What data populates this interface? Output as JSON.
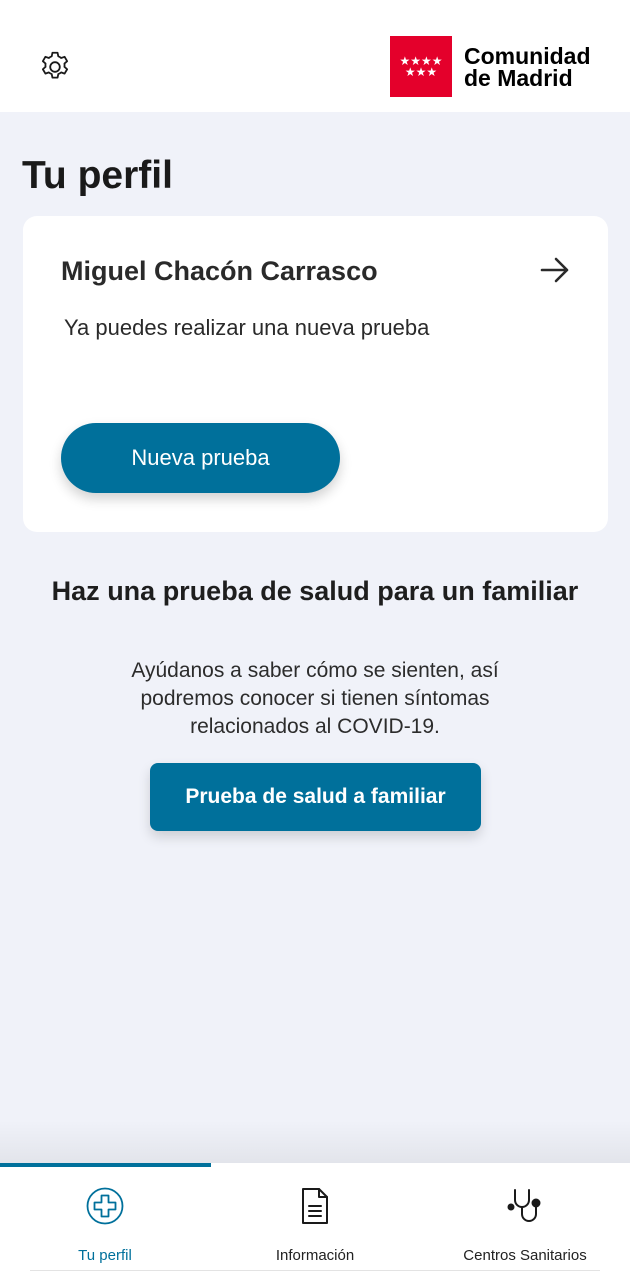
{
  "header": {
    "settings_icon": "gear-icon",
    "logo": {
      "line1": "Comunidad",
      "line2": "de Madrid",
      "flag_color": "#e4002b"
    }
  },
  "page": {
    "title": "Tu perfil"
  },
  "profile_card": {
    "name": "Miguel Chacón Carrasco",
    "subtitle": "Ya puedes realizar una nueva prueba",
    "button_label": "Nueva prueba",
    "arrow_icon": "arrow-right-icon"
  },
  "family_section": {
    "title": "Haz una prueba de salud para un familiar",
    "description": "Ayúdanos a saber cómo se sienten, así podremos conocer si tienen síntomas relacionados al COVID-19.",
    "button_label": "Prueba de salud a familiar"
  },
  "tabbar": {
    "active_index": 0,
    "accent_color": "#00709b",
    "tabs": [
      {
        "label": "Tu perfil",
        "icon": "medical-cross-icon"
      },
      {
        "label": "Información",
        "icon": "document-icon"
      },
      {
        "label": "Centros Sanitarios",
        "icon": "stethoscope-icon"
      }
    ]
  }
}
